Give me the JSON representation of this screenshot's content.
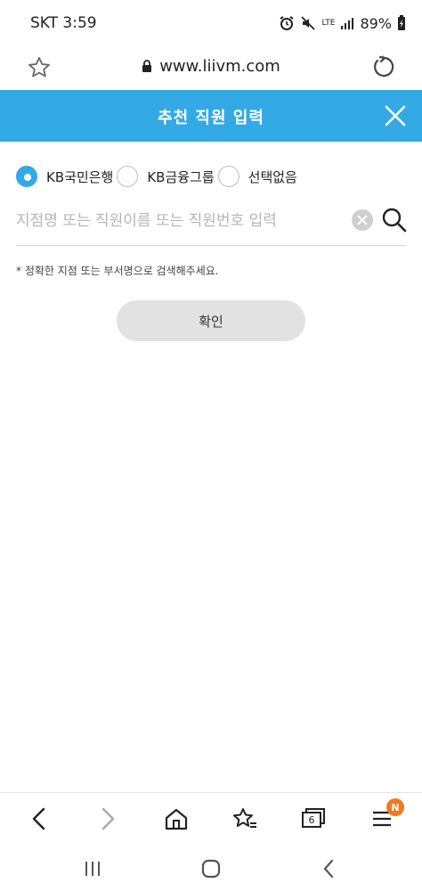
{
  "status_bar": {
    "carrier_time": "SKT 3:59",
    "network": "LTE",
    "battery": "89%"
  },
  "browser": {
    "url": "www.liivm.com",
    "tab_count": "6",
    "menu_badge": "N"
  },
  "modal": {
    "title": "추천 직원 입력",
    "radio_options": [
      {
        "label": "KB국민은행",
        "checked": true
      },
      {
        "label": "KB금융그룹",
        "checked": false
      },
      {
        "label": "선택없음",
        "checked": false
      }
    ],
    "search_placeholder": "지점명 또는 직원이름 또는 직원번호 입력",
    "search_value": "",
    "notice": "* 정확한 지점 또는 부서명으로 검색해주세요.",
    "confirm_label": "확인"
  },
  "colors": {
    "accent": "#33a9e5",
    "badge": "#f07a1f",
    "button_bg": "#e2e2e2"
  }
}
